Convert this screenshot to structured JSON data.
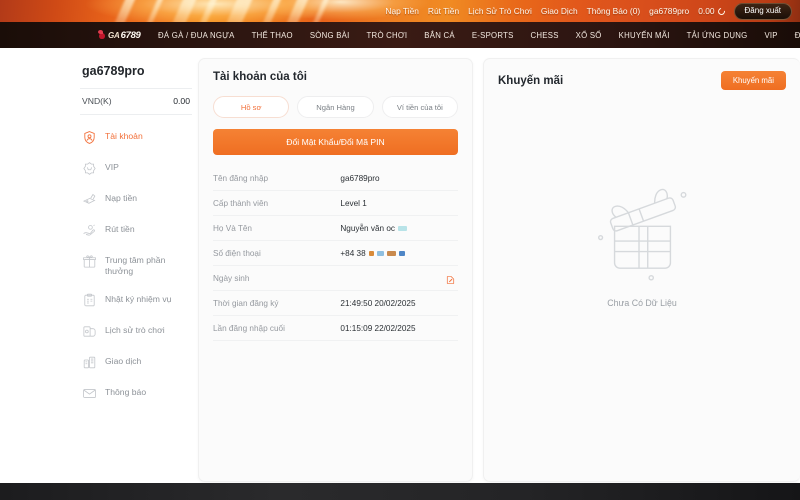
{
  "topbar": {
    "links": [
      "Nạp Tiền",
      "Rút Tiền",
      "Lịch Sử Trò Chơi",
      "Giao Dịch",
      "Thông Báo (0)"
    ],
    "username": "ga6789pro",
    "balance": "0.00",
    "refresh_icon": "refresh-icon",
    "logout_label": "Đăng xuất"
  },
  "nav": {
    "logo": {
      "prefix": "GA",
      "number": "6789",
      "icon": "rooster-icon"
    },
    "items": [
      "ĐÁ GÀ / ĐUA NGỰA",
      "THỂ THAO",
      "SÒNG BÀI",
      "TRÒ CHƠI",
      "BẮN CÁ",
      "E-SPORTS",
      "CHESS",
      "XỔ SỐ",
      "KHUYẾN MÃI",
      "TẢI ỨNG DỤNG",
      "VIP",
      "ĐẠI LÝ"
    ]
  },
  "sidebar": {
    "username": "ga6789pro",
    "currency_label": "VND(K)",
    "currency_value": "0.00",
    "items": [
      {
        "label": "Tài khoản",
        "icon": "user-shield-icon",
        "active": true
      },
      {
        "label": "VIP",
        "icon": "vip-badge-icon",
        "active": false
      },
      {
        "label": "Nạp tiền",
        "icon": "deposit-icon",
        "active": false
      },
      {
        "label": "Rút tiền",
        "icon": "withdraw-icon",
        "active": false
      },
      {
        "label": "Trung tâm phần thưởng",
        "icon": "gift-icon",
        "active": false
      },
      {
        "label": "Nhật ký nhiệm vụ",
        "icon": "clipboard-icon",
        "active": false
      },
      {
        "label": "Lịch sử trò chơi",
        "icon": "history-icon",
        "active": false
      },
      {
        "label": "Giao dịch",
        "icon": "transaction-icon",
        "active": false
      },
      {
        "label": "Thông báo",
        "icon": "mail-icon",
        "active": false
      }
    ]
  },
  "account": {
    "title": "Tài khoản của tôi",
    "tabs": [
      {
        "label": "Hồ sơ",
        "active": true
      },
      {
        "label": "Ngân Hàng",
        "active": false
      },
      {
        "label": "Ví tiền của tôi",
        "active": false
      }
    ],
    "pin_button": "Đổi Mật Khẩu/Đổi Mã PIN",
    "rows": [
      {
        "key": "Tên đăng nhập",
        "value": "ga6789pro"
      },
      {
        "key": "Cấp thành viên",
        "value": "Level 1"
      },
      {
        "key": "Họ Và Tên",
        "value": "Nguyễn văn oc",
        "redacted": true
      },
      {
        "key": "Số điện thoại",
        "value": "+84 38",
        "redacted": true
      },
      {
        "key": "Ngày sinh",
        "value": "",
        "edit_icon": "edit-icon"
      },
      {
        "key": "Thời gian đăng ký",
        "value": "21:49:50 20/02/2025"
      },
      {
        "key": "Lần đăng nhập cuối",
        "value": "01:15:09 22/02/2025"
      }
    ]
  },
  "promo": {
    "title": "Khuyến mãi",
    "button": "Khuyến mãi",
    "empty_icon": "gift-box-icon",
    "empty_text": "Chưa Có Dữ Liệu"
  },
  "colors": {
    "accent": "#ef6e22",
    "accent_light": "#f58234",
    "nav_dark": "#2b1510",
    "muted_text": "#95999f"
  }
}
